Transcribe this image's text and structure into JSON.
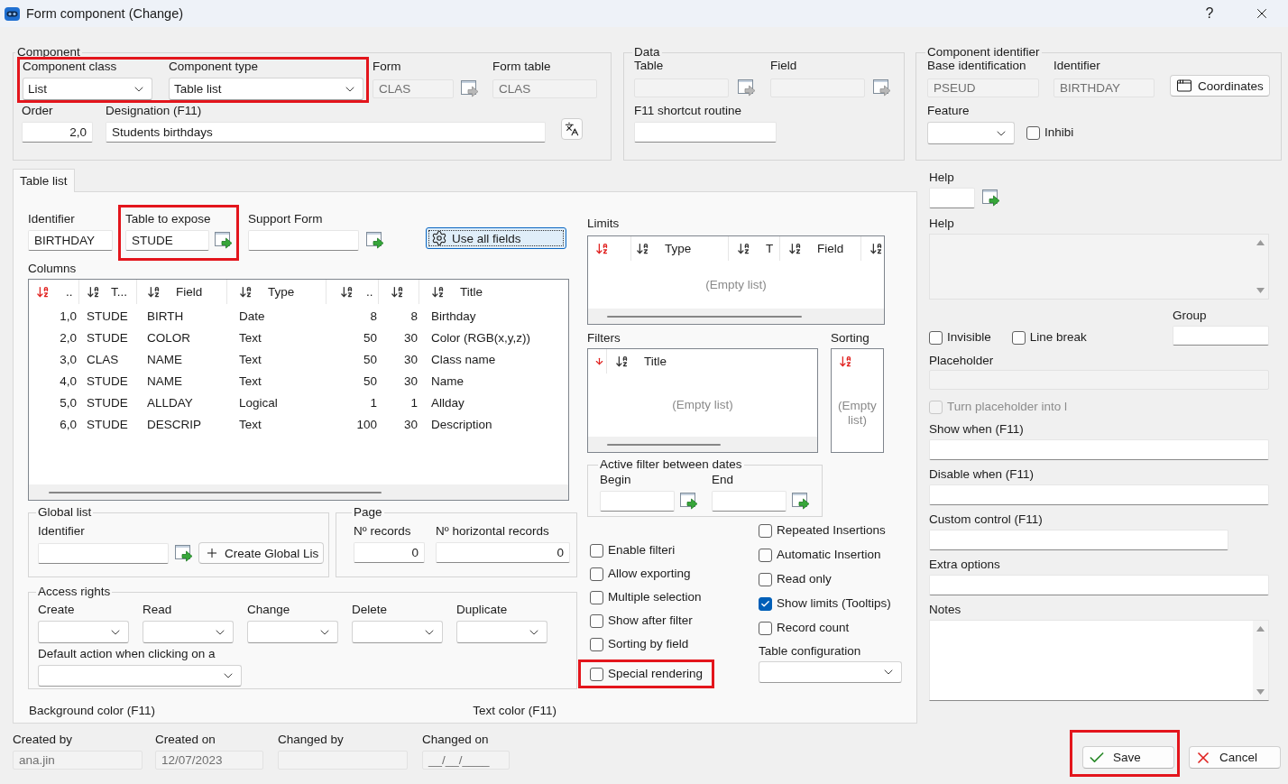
{
  "window": {
    "title": "Form component (Change)",
    "help": "?"
  },
  "component": {
    "legend": "Component",
    "selectors": {
      "highlighted": true,
      "items": [
        {
          "label": "Component class",
          "value": "List"
        },
        {
          "label": "Component type",
          "value": "Table list"
        }
      ]
    },
    "form": {
      "label": "Form",
      "value": "CLAS",
      "disabled": true
    },
    "form_table": {
      "label": "Form table",
      "value": "CLAS",
      "disabled": true
    },
    "order": {
      "label": "Order",
      "value": "2,0"
    },
    "designation": {
      "label": "Designation (F11)",
      "value": "Students birthdays"
    }
  },
  "data": {
    "legend": "Data",
    "table": {
      "label": "Table",
      "disabled": true
    },
    "field": {
      "label": "Field",
      "disabled": true
    },
    "shortcut": {
      "label": "F11 shortcut routine"
    }
  },
  "component_identifier": {
    "legend": "Component identifier",
    "base": {
      "label": "Base identification",
      "value": "PSEUD",
      "disabled": true
    },
    "identifier": {
      "label": "Identifier",
      "value": "BIRTHDAY",
      "disabled": true
    },
    "coordinates_button": "Coordinates",
    "feature": {
      "label": "Feature"
    },
    "inhibit": {
      "label": "Inhibi",
      "checked": false
    }
  },
  "tabs": [
    {
      "label": "Table list",
      "selected": true
    }
  ],
  "table_list": {
    "identifier": {
      "label": "Identifier",
      "value": "BIRTHDAY"
    },
    "table_to_expose": {
      "label": "Table to expose",
      "value": "STUDE",
      "highlighted": true
    },
    "support_form": {
      "label": "Support Form"
    },
    "use_all_fields_button": "Use all fields",
    "columns": {
      "label": "Columns",
      "headers": [
        {
          "kind": "sort",
          "sorted": true,
          "label": ".."
        },
        {
          "kind": "sort",
          "sorted": false,
          "label": "T..."
        },
        {
          "kind": "sort",
          "sorted": false,
          "label": "Field"
        },
        {
          "kind": "sort",
          "sorted": false,
          "label": "Type"
        },
        {
          "kind": "sort",
          "sorted": false,
          "label": ".."
        },
        {
          "kind": "sort",
          "sorted": false
        },
        {
          "kind": "sort",
          "sorted": false,
          "label": "Title"
        }
      ],
      "rows": [
        [
          "1,0",
          "STUDE",
          "BIRTH",
          "Date",
          "8",
          "8",
          "Birthday"
        ],
        [
          "2,0",
          "STUDE",
          "COLOR",
          "Text",
          "50",
          "30",
          "Color (RGB(x,y,z))"
        ],
        [
          "3,0",
          "CLAS",
          "NAME",
          "Text",
          "50",
          "30",
          "Class name"
        ],
        [
          "4,0",
          "STUDE",
          "NAME",
          "Text",
          "50",
          "30",
          "Name"
        ],
        [
          "5,0",
          "STUDE",
          "ALLDAY",
          "Logical",
          "1",
          "1",
          "Allday"
        ],
        [
          "6,0",
          "STUDE",
          "DESCRIP",
          "Text",
          "100",
          "30",
          "Description"
        ]
      ]
    },
    "limits": {
      "label": "Limits",
      "headers": [
        {
          "kind": "sort",
          "sorted": true
        },
        {
          "kind": "sort",
          "sorted": false,
          "label": "Type"
        },
        {
          "kind": "sort",
          "sorted": false,
          "label": "T"
        },
        {
          "kind": "sort",
          "sorted": false,
          "label": "Field"
        },
        {
          "kind": "sort",
          "sorted": false
        }
      ],
      "empty": "(Empty list)"
    },
    "filters": {
      "label": "Filters",
      "headers": [
        {
          "kind": "arrow",
          "sorted": true
        },
        {
          "kind": "sort",
          "sorted": false,
          "label": "Title"
        }
      ],
      "empty": "(Empty list)"
    },
    "sorting": {
      "label": "Sorting",
      "headers": [
        {
          "kind": "sort",
          "sorted": true
        }
      ],
      "empty": "(Empty list)"
    },
    "date_filter": {
      "legend": "Active filter between dates",
      "begin": {
        "label": "Begin"
      },
      "end": {
        "label": "End"
      }
    },
    "global_list": {
      "legend": "Global list",
      "identifier": {
        "label": "Identifier"
      },
      "create_button": "Create Global Lis"
    },
    "page": {
      "legend": "Page",
      "records": {
        "label": "Nº records",
        "value": "0"
      },
      "horizontal_records": {
        "label": "Nº horizontal records",
        "value": "0"
      }
    },
    "access_rights": {
      "legend": "Access rights",
      "selects": [
        {
          "label": "Create"
        },
        {
          "label": "Read"
        },
        {
          "label": "Change"
        },
        {
          "label": "Delete"
        },
        {
          "label": "Duplicate"
        }
      ],
      "default_action": {
        "label": "Default action when clicking on a"
      }
    },
    "options_left": [
      {
        "label": "Enable filteri",
        "checked": false,
        "highlighted": false
      },
      {
        "label": "Allow exporting",
        "checked": false,
        "highlighted": false
      },
      {
        "label": "Multiple selection",
        "checked": false,
        "highlighted": false
      },
      {
        "label": "Show after filter",
        "checked": false,
        "highlighted": false
      },
      {
        "label": "Sorting by field",
        "checked": false,
        "highlighted": false
      },
      {
        "label": "Special rendering",
        "checked": false,
        "highlighted": true
      }
    ],
    "options_right": [
      {
        "label": "Repeated Insertions",
        "checked": false
      },
      {
        "label": "Automatic Insertion",
        "checked": false
      },
      {
        "label": "Read only",
        "checked": false
      },
      {
        "label": "Show limits (Tooltips)",
        "checked": true
      },
      {
        "label": "Record count",
        "checked": false
      }
    ],
    "table_configuration": {
      "label": "Table configuration"
    },
    "background_color": "Background color (F11)",
    "text_color": "Text color (F11)"
  },
  "side_panel": {
    "help_code": {
      "label": "Help"
    },
    "help_text": {
      "label": "Help",
      "disabled": true
    },
    "group": {
      "label": "Group"
    },
    "checkboxes": [
      {
        "label": "Invisible",
        "checked": false
      },
      {
        "label": "Line break",
        "checked": false
      }
    ],
    "placeholder": {
      "label": "Placeholder",
      "disabled": true
    },
    "placeholder_option": {
      "label": "Turn placeholder into l",
      "checked": false,
      "disabled": true
    },
    "fields": [
      {
        "label": "Show when (F11)"
      },
      {
        "label": "Disable when (F11)"
      },
      {
        "label": "Custom control (F11)"
      },
      {
        "label": "Extra options"
      }
    ],
    "notes": {
      "label": "Notes"
    }
  },
  "audit": [
    {
      "label": "Created by",
      "value": "ana.jin",
      "disabled": true
    },
    {
      "label": "Created on",
      "value": "12/07/2023",
      "disabled": true
    },
    {
      "label": "Changed by",
      "disabled": true
    },
    {
      "label": "Changed on",
      "value": "__/__/____",
      "disabled": true
    }
  ],
  "buttons": [
    {
      "kind": "save",
      "label": "Save",
      "highlighted": true
    },
    {
      "kind": "cancel",
      "label": "Cancel",
      "highlighted": false
    }
  ]
}
